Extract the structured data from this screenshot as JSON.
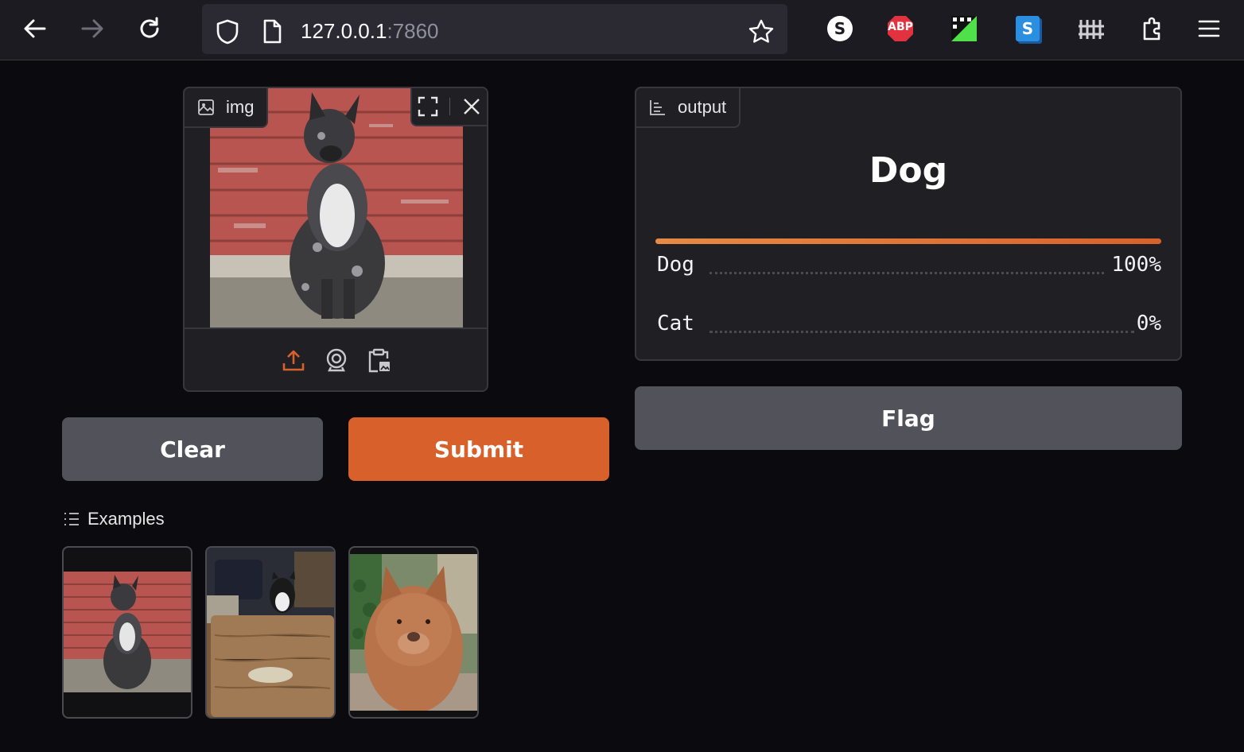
{
  "browser": {
    "url_host": "127.0.0.1",
    "url_port": ":7860",
    "extensions": [
      "s-extension-icon",
      "adblock-plus-icon",
      "grid-extension-icon",
      "s-blue-extension-icon",
      "fence-extension-icon",
      "puzzle-extensions-icon"
    ],
    "adblock_label": "ABP",
    "s_label": "S",
    "s_blue_label": "S"
  },
  "input": {
    "label": "img"
  },
  "output": {
    "label": "output",
    "predicted_class": "Dog",
    "confidences": [
      {
        "label": "Dog",
        "percent": "100%",
        "value": 1.0
      },
      {
        "label": "Cat",
        "percent": "0%",
        "value": 0.0
      }
    ]
  },
  "buttons": {
    "clear": "Clear",
    "submit": "Submit",
    "flag": "Flag"
  },
  "examples": {
    "label": "Examples",
    "items": [
      "dog-merle-example",
      "cat-example",
      "puppy-example"
    ]
  },
  "colors": {
    "accent": "#d8612b",
    "secondary_button": "#52525b",
    "background": "#0b0b0f"
  }
}
